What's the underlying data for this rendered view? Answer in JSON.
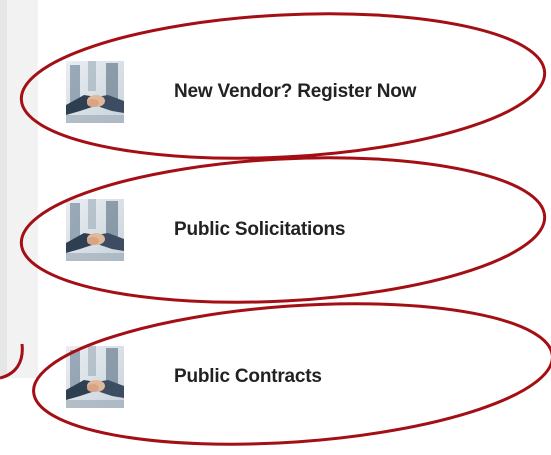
{
  "menu": {
    "items": [
      {
        "label": "New Vendor? Register Now",
        "icon": "handshake-icon"
      },
      {
        "label": "Public Solicitations",
        "icon": "handshake-icon"
      },
      {
        "label": "Public Contracts",
        "icon": "handshake-icon"
      }
    ]
  },
  "colors": {
    "annotation": "#a30f14",
    "text": "#222222",
    "sidebar": "#f2f2f2"
  }
}
